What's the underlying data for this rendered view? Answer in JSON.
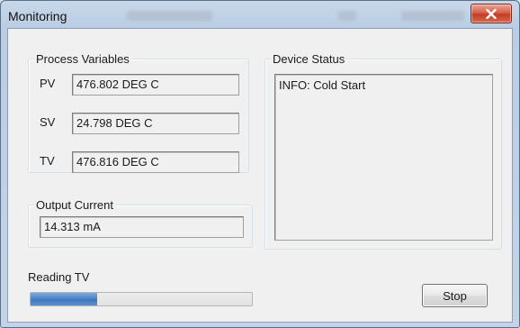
{
  "window": {
    "title": "Monitoring"
  },
  "process_variables": {
    "group_label": "Process Variables",
    "rows": [
      {
        "label": "PV",
        "value": "476.802 DEG C"
      },
      {
        "label": "SV",
        "value": "24.798 DEG C"
      },
      {
        "label": "TV",
        "value": "476.816 DEG C"
      }
    ]
  },
  "output_current": {
    "group_label": "Output Current",
    "value": "14.313 mA"
  },
  "device_status": {
    "group_label": "Device Status",
    "text": "INFO: Cold Start"
  },
  "reading": {
    "label": "Reading TV",
    "progress_fraction": 0.3
  },
  "buttons": {
    "stop_label": "Stop"
  },
  "colors": {
    "progress_fill": "#4f86c6",
    "close_button": "#c94a31"
  }
}
